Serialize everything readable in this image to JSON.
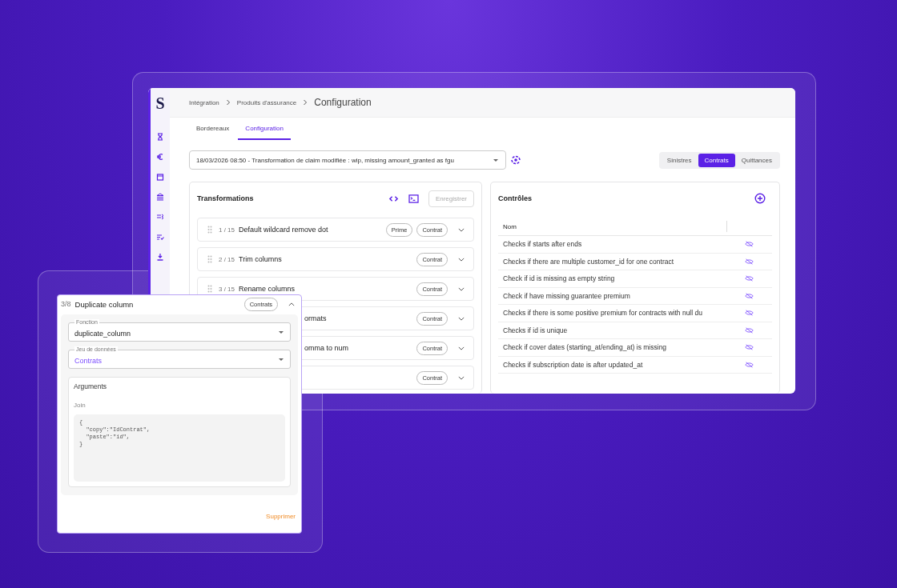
{
  "sidebar": {
    "logo": "S"
  },
  "breadcrumb": [
    "Intégration",
    "Produits d'assurance"
  ],
  "page_title": "Configuration",
  "tabs": [
    {
      "label": "Bordereaux",
      "selected": false
    },
    {
      "label": "Configuration",
      "selected": true
    }
  ],
  "version_select": {
    "value": "18/03/2026 08:50 - Transformation de claim modifiée : wip, missing amount_granted as fgu"
  },
  "segments": [
    {
      "label": "Sinistres",
      "selected": false
    },
    {
      "label": "Contrats",
      "selected": true
    },
    {
      "label": "Quittances",
      "selected": false
    }
  ],
  "transformations": {
    "title": "Transformations",
    "save_button": {
      "label": "Enregistrer",
      "disabled": true
    },
    "rows": [
      {
        "kind": "full",
        "index": "1 / 15",
        "name": "Default wildcard remove dot",
        "tags": [
          "Prime",
          "Contrat"
        ]
      },
      {
        "kind": "full",
        "index": "2 / 15",
        "name": "Trim columns",
        "tags": [
          "Contrat"
        ]
      },
      {
        "kind": "full",
        "index": "3 / 15",
        "name": "Rename columns",
        "tags": [
          "Contrat"
        ]
      },
      {
        "kind": "covered",
        "name": "ormats",
        "tags": [
          "Contrat"
        ]
      },
      {
        "kind": "covered",
        "name": "omma to num",
        "tags": [
          "Contrat"
        ]
      },
      {
        "kind": "covered",
        "tags": [
          "Contrat"
        ]
      }
    ]
  },
  "controls": {
    "title": "Contrôles",
    "column": "Nom",
    "rows": [
      "Checks if starts after ends",
      "Checks if there are multiple customer_id for one contract",
      "Check if id is missing as empty string",
      "Check if have missing guarantee premium",
      "Checks if there is some positive premium for contracts with null du",
      "Checks if id is unique",
      "Check if cover dates (starting_at/ending_at) is missing",
      "Checks if subscription date is after updated_at"
    ]
  },
  "detail_card": {
    "index": "3/8",
    "name": "Duplicate column",
    "tag": "Contrats",
    "expanded": true,
    "function_field": {
      "label": "Fonction",
      "value": "duplicate_column"
    },
    "dataset_field": {
      "label": "Jeu de données",
      "value": "Contrats"
    },
    "arguments": {
      "title": "Arguments",
      "join_label": "Join",
      "code": [
        "{",
        "  \"copy\":\"IdContrat\",",
        "  \"paste\":\"id\",",
        "}"
      ]
    },
    "delete_button": "Supprimer"
  }
}
